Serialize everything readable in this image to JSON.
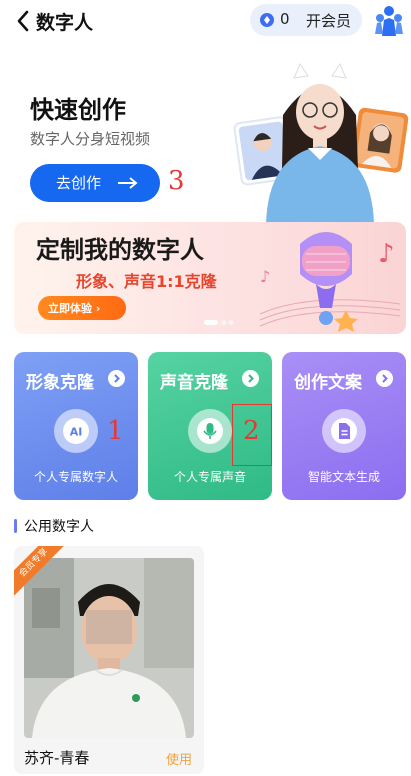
{
  "header": {
    "title": "数字人",
    "coin_count": "0",
    "vip_label": "开会员"
  },
  "hero": {
    "title": "快速创作",
    "subtitle": "数字人分身短视频",
    "create_button": "去创作"
  },
  "banner": {
    "title": "定制我的数字人",
    "subtitle": "形象、声音1:1克隆",
    "try_button": "立即体验 ›"
  },
  "cards": [
    {
      "title": "形象克隆",
      "caption": "个人专属数字人",
      "icon": "ai-icon"
    },
    {
      "title": "声音克隆",
      "caption": "个人专属声音",
      "icon": "microphone-icon"
    },
    {
      "title": "创作文案",
      "caption": "智能文本生成",
      "icon": "document-icon"
    }
  ],
  "annotations": [
    "1",
    "2",
    "3"
  ],
  "public_section": {
    "title": "公用数字人",
    "items": [
      {
        "name": "苏齐-青春",
        "use_label": "使用",
        "tag": "会员专享"
      }
    ]
  },
  "colors": {
    "primary": "#1668f0",
    "accent_orange": "#ff6a13",
    "annotation_red": "#e53935"
  }
}
